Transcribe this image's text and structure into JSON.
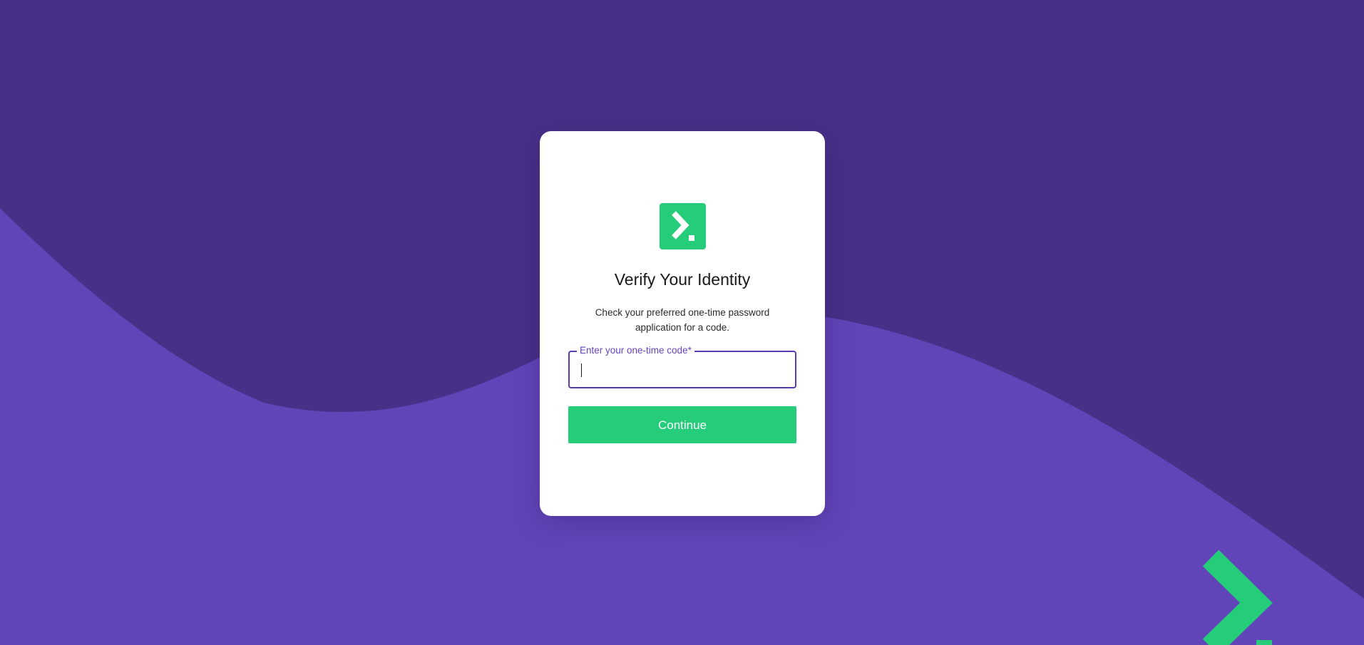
{
  "colors": {
    "background_dark": "#483089",
    "background_light": "#6244b9",
    "accent_green": "#25cd7b",
    "field_border": "#5a3bb4",
    "field_label": "#6744bf"
  },
  "card": {
    "logo_icon": "brand-chevron-icon",
    "title": "Verify Your Identity",
    "subtitle": "Check your preferred one-time password application for a code.",
    "code_field": {
      "label": "Enter your one-time code*",
      "value": "",
      "placeholder": ""
    },
    "continue_label": "Continue"
  },
  "decor": {
    "corner_icon": "brand-chevron-icon"
  }
}
